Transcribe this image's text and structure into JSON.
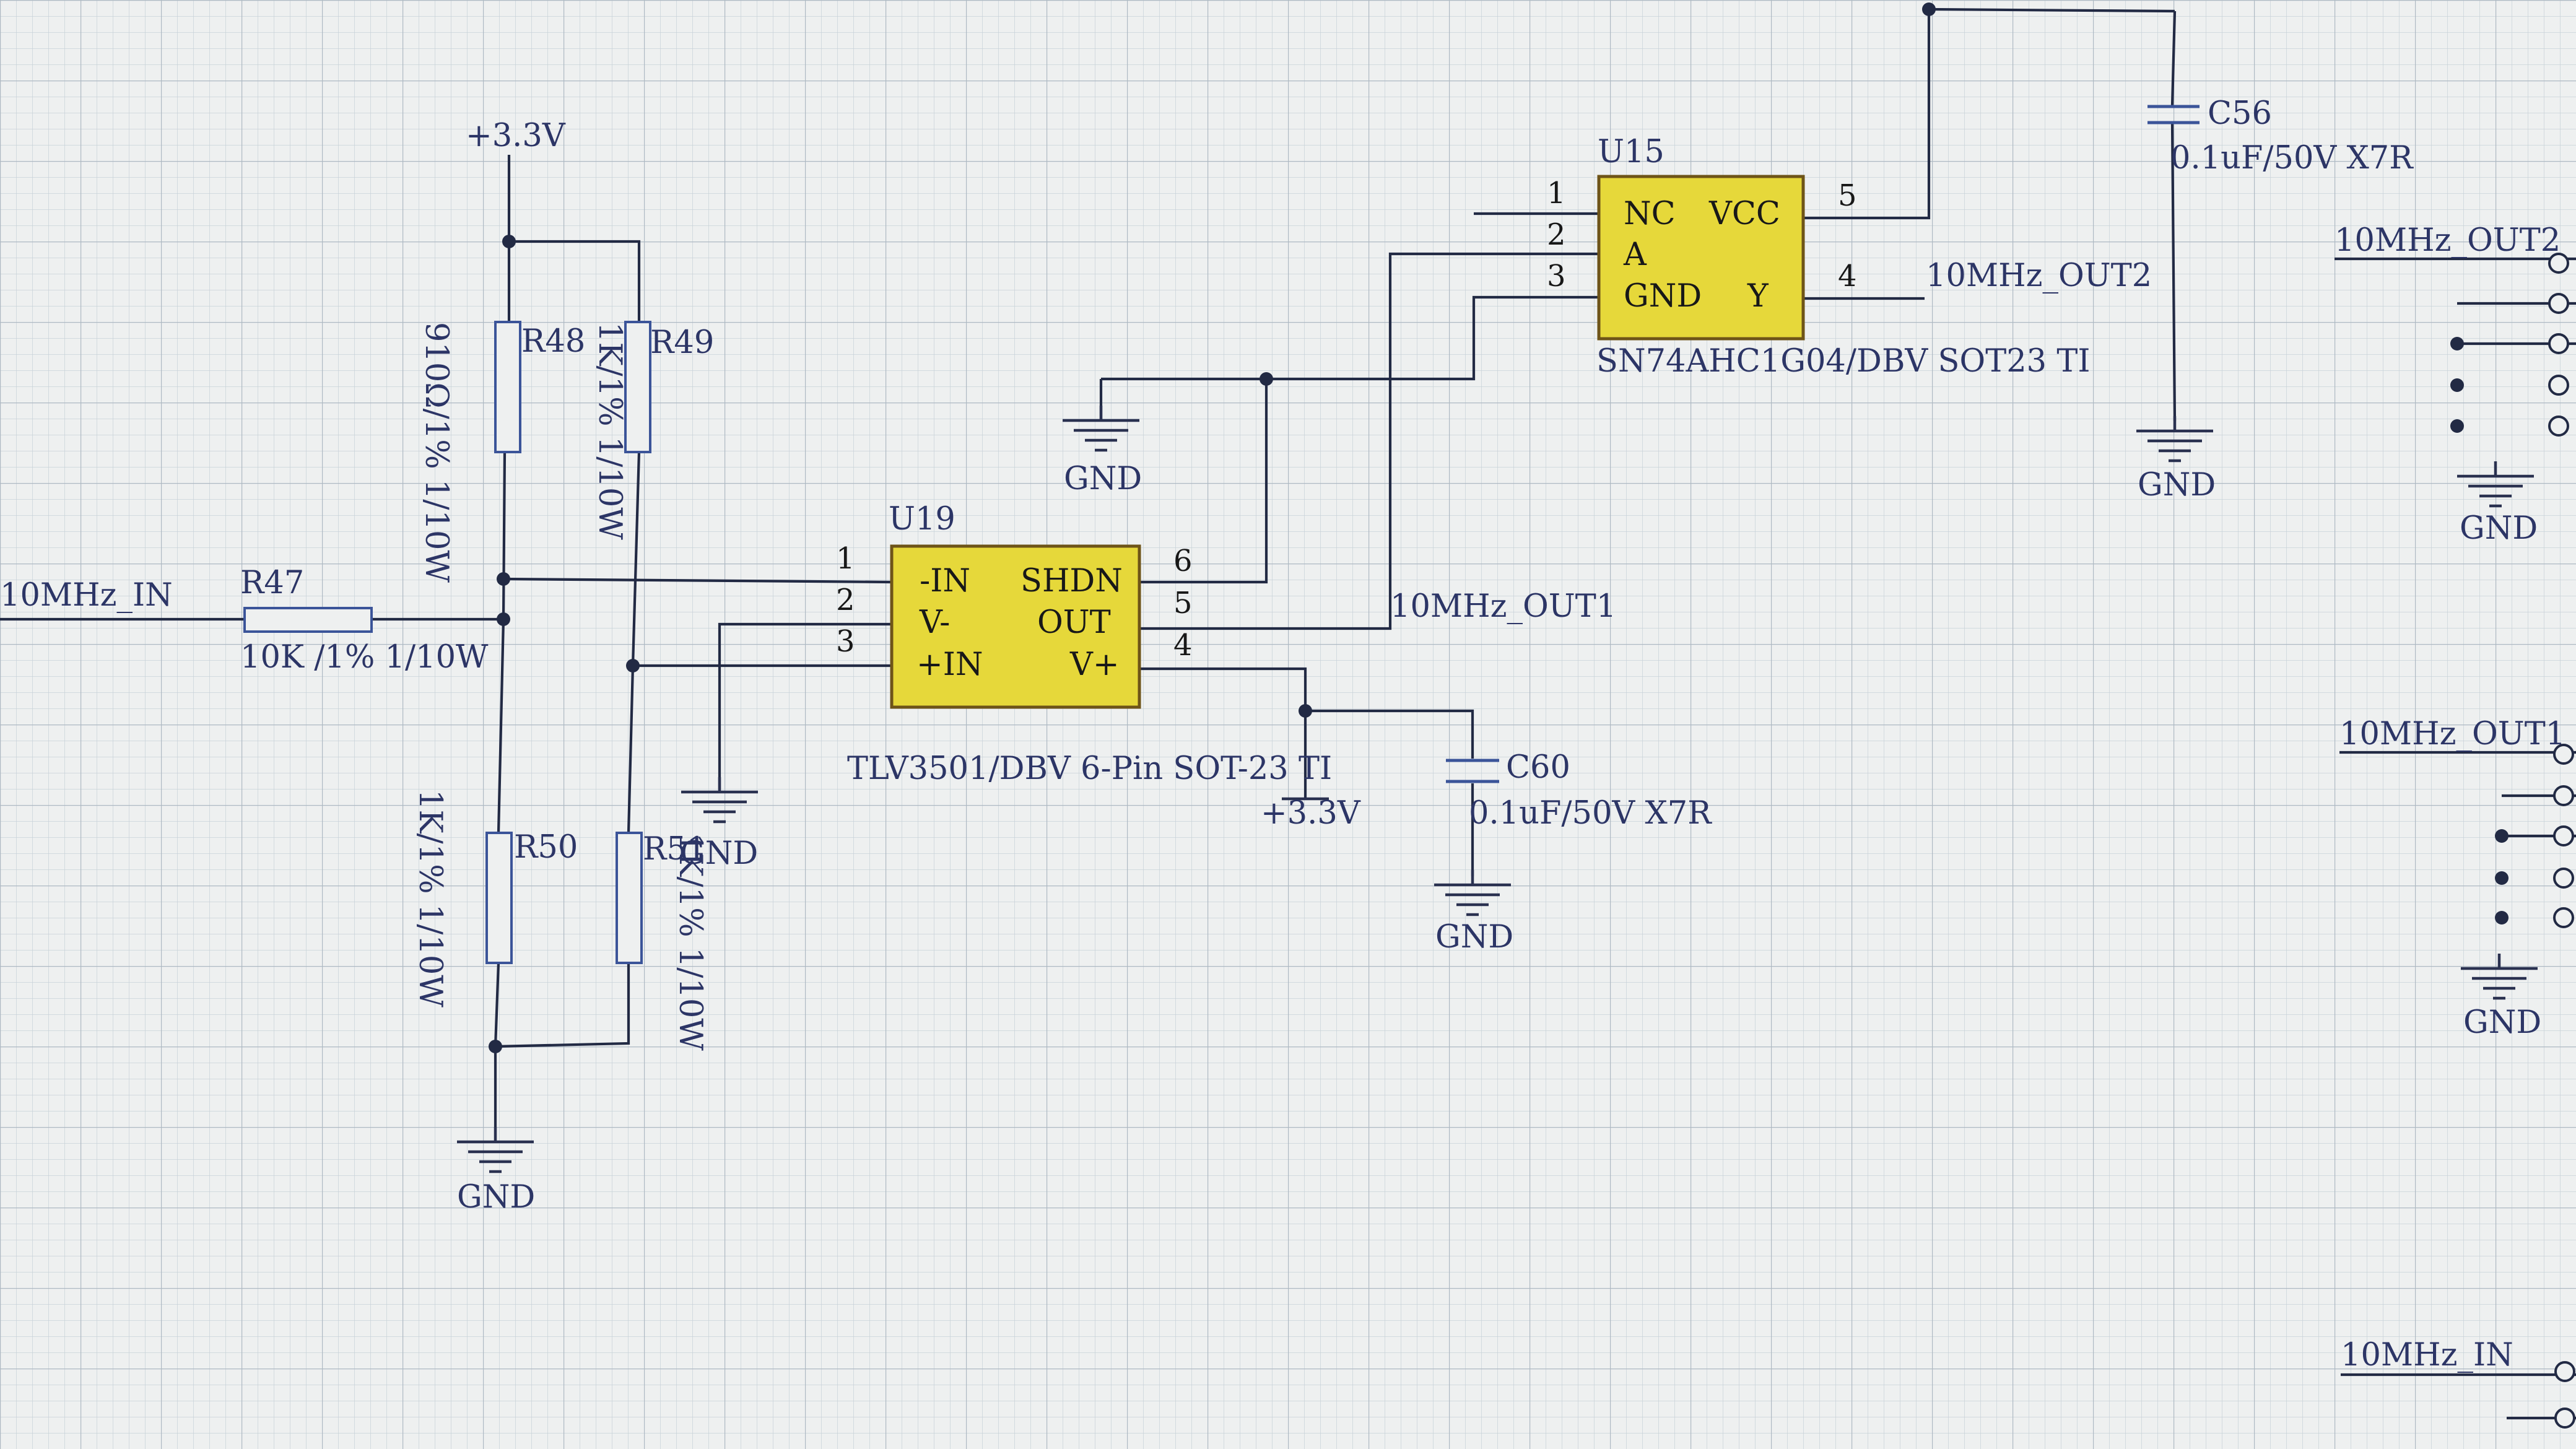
{
  "labels": {
    "v33_top": "+3.3V",
    "v33_u19": "+3.3V",
    "net_10mhz_in": "10MHz_IN",
    "net_10mhz_out1": "10MHz_OUT1",
    "net_10mhz_out2": "10MHz_OUT2",
    "conn_out2": "10MHz_OUT2",
    "conn_out1": "10MHz_OUT1",
    "conn_in": "10MHz_IN",
    "gnd": "GND"
  },
  "components": {
    "r47": {
      "ref": "R47",
      "value": "10K /1% 1/10W"
    },
    "r48": {
      "ref": "R48",
      "value": "910Ω/1% 1/10W"
    },
    "r49": {
      "ref": "R49",
      "value": "1K/1% 1/10W"
    },
    "r50": {
      "ref": "R50",
      "value": "1K/1% 1/10W"
    },
    "r51": {
      "ref": "R51",
      "value": "1K/1% 1/10W"
    },
    "c56": {
      "ref": "C56",
      "value": "0.1uF/50V X7R"
    },
    "c60": {
      "ref": "C60",
      "value": "0.1uF/50V X7R"
    },
    "u15": {
      "ref": "U15",
      "part": "SN74AHC1G04/DBV  SOT23 TI",
      "pins": [
        {
          "num": "1",
          "name": "NC"
        },
        {
          "num": "2",
          "name": "A"
        },
        {
          "num": "3",
          "name": "GND"
        },
        {
          "num": "5",
          "name": "VCC"
        },
        {
          "num": "4",
          "name": "Y"
        }
      ]
    },
    "u19": {
      "ref": "U19",
      "part": "TLV3501/DBV 6-Pin SOT-23 TI",
      "pins": [
        {
          "num": "1",
          "name": "-IN"
        },
        {
          "num": "2",
          "name": "V-"
        },
        {
          "num": "3",
          "name": "+IN"
        },
        {
          "num": "6",
          "name": "SHDN"
        },
        {
          "num": "5",
          "name": "OUT"
        },
        {
          "num": "4",
          "name": "V+"
        }
      ]
    }
  },
  "colors": {
    "chip_fill": "#e6d83a",
    "wire": "#222a44",
    "component_outline": "#3b5499",
    "text": "#2c3566",
    "grid": "#b9c3cc",
    "background": "#eef0f0"
  }
}
